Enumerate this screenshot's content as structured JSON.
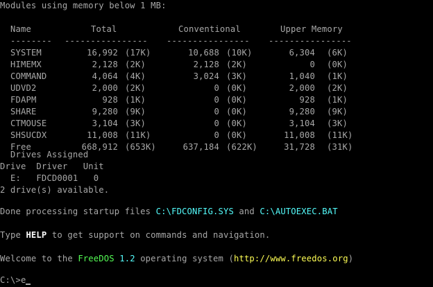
{
  "title": "Modules using memory below 1 MB:",
  "table": {
    "headers": {
      "name": "Name",
      "total": "Total",
      "conventional": "Conventional",
      "upper": "Upper Memory"
    },
    "underline": {
      "name": "--------",
      "total": "----------------",
      "conventional": "----------------",
      "upper": "----------------"
    },
    "rows": [
      {
        "name": "SYSTEM",
        "total": "16,992",
        "total_k": "(17K)",
        "conv": "10,688",
        "conv_k": "(10K)",
        "upper": "6,304",
        "upper_k": "(6K)"
      },
      {
        "name": "HIMEMX",
        "total": "2,128",
        "total_k": "(2K)",
        "conv": "2,128",
        "conv_k": "(2K)",
        "upper": "0",
        "upper_k": "(0K)"
      },
      {
        "name": "COMMAND",
        "total": "4,064",
        "total_k": "(4K)",
        "conv": "3,024",
        "conv_k": "(3K)",
        "upper": "1,040",
        "upper_k": "(1K)"
      },
      {
        "name": "UDVD2",
        "total": "2,000",
        "total_k": "(2K)",
        "conv": "0",
        "conv_k": "(0K)",
        "upper": "2,000",
        "upper_k": "(2K)"
      },
      {
        "name": "FDAPM",
        "total": "928",
        "total_k": "(1K)",
        "conv": "0",
        "conv_k": "(0K)",
        "upper": "928",
        "upper_k": "(1K)"
      },
      {
        "name": "SHARE",
        "total": "9,280",
        "total_k": "(9K)",
        "conv": "0",
        "conv_k": "(0K)",
        "upper": "9,280",
        "upper_k": "(9K)"
      },
      {
        "name": "CTMOUSE",
        "total": "3,104",
        "total_k": "(3K)",
        "conv": "0",
        "conv_k": "(0K)",
        "upper": "3,104",
        "upper_k": "(3K)"
      },
      {
        "name": "SHSUCDX",
        "total": "11,008",
        "total_k": "(11K)",
        "conv": "0",
        "conv_k": "(0K)",
        "upper": "11,008",
        "upper_k": "(11K)"
      },
      {
        "name": "Free",
        "total": "668,912",
        "total_k": "(653K)",
        "conv": "637,184",
        "conv_k": "(622K)",
        "upper": "31,728",
        "upper_k": "(31K)"
      }
    ]
  },
  "drives": {
    "assigned_title": "Drives Assigned",
    "header": "Drive  Driver   Unit",
    "row": "  E:   FDCD0001   0",
    "available": "2 drive(s) available."
  },
  "startup": {
    "prefix": "Done processing startup files ",
    "config_file": "C:\\FDCONFIG.SYS",
    "and": " and ",
    "autoexec_file": "C:\\AUTOEXEC.BAT"
  },
  "help": {
    "prefix": "Type ",
    "keyword": "HELP",
    "suffix": " to get support on commands and navigation."
  },
  "welcome": {
    "prefix": "Welcome to the ",
    "os_name": "FreeDOS",
    "space": " ",
    "version": "1.2",
    "middle": " operating system (",
    "url": "http://www.freedos.org",
    "suffix": ")"
  },
  "prompt": {
    "path": "C:\\>",
    "input": "e"
  },
  "colors": {
    "background": "#000000",
    "text": "#a8a8a8",
    "highlight_green": "#54fc54",
    "highlight_cyan": "#54fcfc",
    "highlight_yellow": "#fcfc54",
    "highlight_white": "#fcfcfc"
  }
}
